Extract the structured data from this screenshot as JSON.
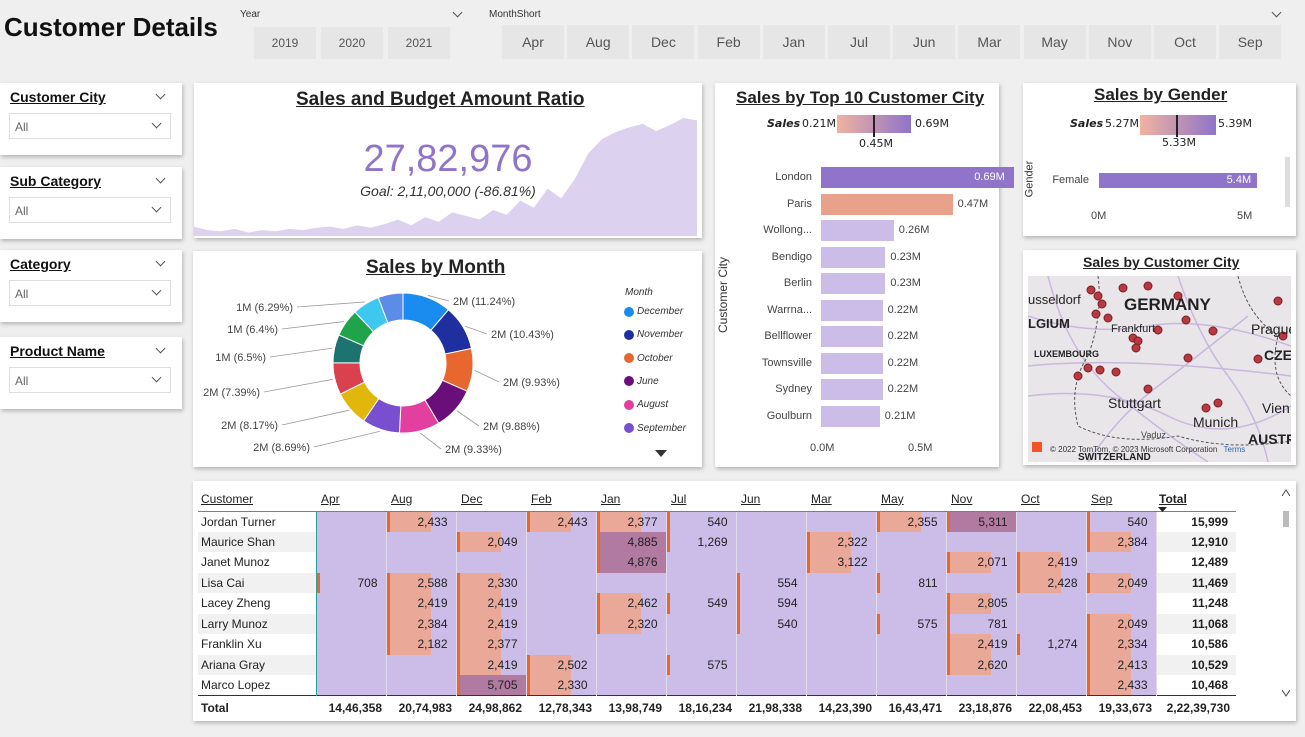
{
  "page_title": "Customer Details",
  "year_slicer": {
    "label": "Year",
    "options": [
      "2019",
      "2020",
      "2021"
    ]
  },
  "month_slicer": {
    "label": "MonthShort",
    "options": [
      "Apr",
      "Aug",
      "Dec",
      "Feb",
      "Jan",
      "Jul",
      "Jun",
      "Mar",
      "May",
      "Nov",
      "Oct",
      "Sep"
    ]
  },
  "filters": [
    {
      "title": "Customer City",
      "value": "All"
    },
    {
      "title": "Sub Category",
      "value": "All"
    },
    {
      "title": "Category",
      "value": "All"
    },
    {
      "title": "Product Name",
      "value": "All"
    }
  ],
  "kpi": {
    "title": "Sales and Budget Amount Ratio",
    "value": "27,82,976",
    "goal": "Goal: 2,11,00,000 (-86.81%)",
    "sparkline": [
      8,
      5,
      4,
      6,
      3,
      5,
      4,
      6,
      5,
      7,
      8,
      6,
      9,
      7,
      10,
      14,
      9,
      16,
      12,
      20,
      17,
      14,
      22,
      18,
      30,
      24,
      40,
      32,
      48,
      70,
      82,
      88,
      92,
      95,
      89,
      94,
      100,
      98
    ]
  },
  "top_cities": {
    "title": "Sales by Top 10 Customer City",
    "axis_title": "Customer City",
    "legend_label": "Sales",
    "legend_min": "0.21M",
    "legend_max": "0.69M",
    "legend_mid": "0.45M",
    "ticks": [
      "0.0M",
      "0.5M"
    ]
  },
  "gender": {
    "title": "Sales by Gender",
    "axis_title": "Gender",
    "legend_label": "Sales",
    "legend_min": "5.27M",
    "legend_max": "5.39M",
    "legend_mid": "5.33M",
    "ticks": [
      "0M",
      "5M"
    ]
  },
  "month_donut": {
    "title": "Sales by Month",
    "legend_title": "Month",
    "legend": [
      {
        "name": "December",
        "color": "#1a8cf0"
      },
      {
        "name": "November",
        "color": "#1f2fa0"
      },
      {
        "name": "October",
        "color": "#e8672e"
      },
      {
        "name": "June",
        "color": "#6a0f7a"
      },
      {
        "name": "August",
        "color": "#e23fa0"
      },
      {
        "name": "September",
        "color": "#7a4fcf"
      }
    ]
  },
  "map": {
    "title": "Sales by Customer City",
    "labels": {
      "germany": "GERMANY",
      "belgium": "LGIUM",
      "luxembourg": "LUXEMBOURG",
      "frankfurt": "Frankfurt",
      "stuttgart": "Stuttgart",
      "munich": "Munich",
      "prague": "Prague",
      "czech": "CZE",
      "vienna": "Vien",
      "austria": "AUSTRI",
      "switzerland": "SWITZERLAND",
      "vaduz": "Vaduz",
      "dusseldorf": "usseldorf"
    },
    "attribution": "© 2022 TomTom, © 2023 Microsoft Corporation",
    "terms": "Terms"
  },
  "matrix": {
    "col_customer": "Customer",
    "months": [
      "Apr",
      "Aug",
      "Dec",
      "Feb",
      "Jan",
      "Jul",
      "Jun",
      "Mar",
      "May",
      "Nov",
      "Oct",
      "Sep"
    ],
    "col_total": "Total",
    "rows": [
      {
        "name": "Jordan Turner",
        "vals": [
          "",
          "2,433",
          "",
          "2,443",
          "2,377",
          "540",
          "",
          "",
          "2,355",
          "5,311",
          "",
          "540"
        ],
        "total": "15,999"
      },
      {
        "name": "Maurice Shan",
        "vals": [
          "",
          "",
          "2,049",
          "",
          "4,885",
          "1,269",
          "",
          "2,322",
          "",
          "",
          "",
          "2,384"
        ],
        "total": "12,910"
      },
      {
        "name": "Janet Munoz",
        "vals": [
          "",
          "",
          "",
          "",
          "4,876",
          "",
          "",
          "3,122",
          "",
          "2,071",
          "2,419",
          ""
        ],
        "total": "12,489"
      },
      {
        "name": "Lisa Cai",
        "vals": [
          "708",
          "2,588",
          "2,330",
          "",
          "",
          "",
          "554",
          "",
          "811",
          "",
          "2,428",
          "2,049"
        ],
        "total": "11,469"
      },
      {
        "name": "Lacey Zheng",
        "vals": [
          "",
          "2,419",
          "2,419",
          "",
          "2,462",
          "549",
          "594",
          "",
          "",
          "2,805",
          "",
          ""
        ],
        "total": "11,248"
      },
      {
        "name": "Larry Munoz",
        "vals": [
          "",
          "2,384",
          "2,419",
          "",
          "2,320",
          "",
          "540",
          "",
          "575",
          "781",
          "",
          "2,049"
        ],
        "total": "11,068"
      },
      {
        "name": "Franklin Xu",
        "vals": [
          "",
          "2,182",
          "2,377",
          "",
          "",
          "",
          "",
          "",
          "",
          "2,419",
          "1,274",
          "2,334"
        ],
        "total": "10,586"
      },
      {
        "name": "Ariana Gray",
        "vals": [
          "",
          "",
          "2,419",
          "2,502",
          "",
          "575",
          "",
          "",
          "",
          "2,620",
          "",
          "2,413"
        ],
        "total": "10,529"
      },
      {
        "name": "Marco Lopez",
        "vals": [
          "",
          "",
          "5,705",
          "2,330",
          "",
          "",
          "",
          "",
          "",
          "",
          "",
          "2,433"
        ],
        "total": "10,468"
      }
    ],
    "total_label": "Total",
    "totals": [
      "14,46,358",
      "20,74,983",
      "24,98,862",
      "12,78,343",
      "13,98,749",
      "18,16,234",
      "21,98,338",
      "14,23,390",
      "16,43,471",
      "23,18,876",
      "22,08,453",
      "19,33,673"
    ],
    "grand_total": "2,22,39,730"
  },
  "chart_data": [
    {
      "type": "bar",
      "title": "Sales by Top 10 Customer City",
      "ylabel": "Customer City",
      "categories": [
        "London",
        "Paris",
        "Wollong...",
        "Bendigo",
        "Berlin",
        "Warrna...",
        "Bellflower",
        "Townsville",
        "Sydney",
        "Goulburn"
      ],
      "values": [
        0.69,
        0.47,
        0.26,
        0.23,
        0.23,
        0.22,
        0.22,
        0.22,
        0.22,
        0.21
      ],
      "value_labels": [
        "0.69M",
        "0.47M",
        "0.26M",
        "0.23M",
        "0.23M",
        "0.22M",
        "0.22M",
        "0.22M",
        "0.22M",
        "0.21M"
      ],
      "xlim": [
        0,
        0.7
      ]
    },
    {
      "type": "bar",
      "title": "Sales by Gender",
      "ylabel": "Gender",
      "categories": [
        "Female"
      ],
      "values": [
        5.4
      ],
      "value_labels": [
        "5.4M"
      ],
      "xlim": [
        0,
        5.6
      ]
    },
    {
      "type": "pie",
      "title": "Sales by Month",
      "slices": [
        {
          "label": "2M (11.24%)",
          "pct": 11.24,
          "color": "#1a8cf0"
        },
        {
          "label": "2M (10.43%)",
          "pct": 10.43,
          "color": "#1f2fa0"
        },
        {
          "label": "2M (9.93%)",
          "pct": 9.93,
          "color": "#e8672e"
        },
        {
          "label": "2M (9.88%)",
          "pct": 9.88,
          "color": "#6a0f7a"
        },
        {
          "label": "2M (9.33%)",
          "pct": 9.33,
          "color": "#e23fa0"
        },
        {
          "label": "2M (8.69%)",
          "pct": 8.69,
          "color": "#7a4fcf"
        },
        {
          "label": "2M (8.17%)",
          "pct": 8.17,
          "color": "#e0b70a"
        },
        {
          "label": "2M (7.39%)",
          "pct": 7.39,
          "color": "#d9414f"
        },
        {
          "label": "1M (6.5%)",
          "pct": 6.5,
          "color": "#1d7370"
        },
        {
          "label": "1M (6.4%)",
          "pct": 6.4,
          "color": "#1fa34b"
        },
        {
          "label": "1M (6.29%)",
          "pct": 6.29,
          "color": "#3ec8f0"
        },
        {
          "label": "",
          "pct": 5.75,
          "color": "#5b8de8"
        }
      ]
    }
  ]
}
